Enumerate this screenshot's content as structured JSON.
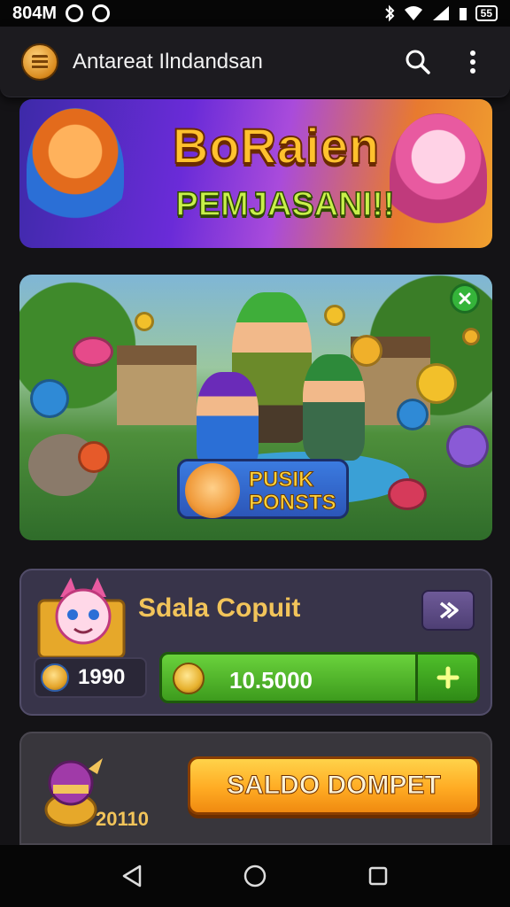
{
  "status_bar": {
    "time": "804M",
    "battery": "55"
  },
  "app_bar": {
    "title": "Antareat Ilndandsan",
    "icons": [
      "app-logo-icon",
      "search-icon",
      "more-vert-icon"
    ]
  },
  "banner": {
    "title": "BoRaien",
    "subtitle": "PEMJASANI!!"
  },
  "scene": {
    "badge_line1": "PUSIK",
    "badge_line2": "PONSTS",
    "close_icon": "close-icon"
  },
  "wallet": {
    "title": "Sdala Copuit",
    "coins_value": "1990",
    "balance_value": "10.5000",
    "arrow_icon": "chevron-right-icon",
    "plus_icon": "plus-icon"
  },
  "saldo": {
    "value": "20110",
    "button_label": "SALDO DOMPET"
  },
  "nav_bar": {
    "icons": [
      "back-icon",
      "home-icon",
      "recents-icon"
    ]
  },
  "colors": {
    "background": "#141316",
    "wallet_card": "#38344a",
    "green_button": "#4fbf2a",
    "orange_button": "#ffab23",
    "gold_text": "#f2c45a"
  }
}
